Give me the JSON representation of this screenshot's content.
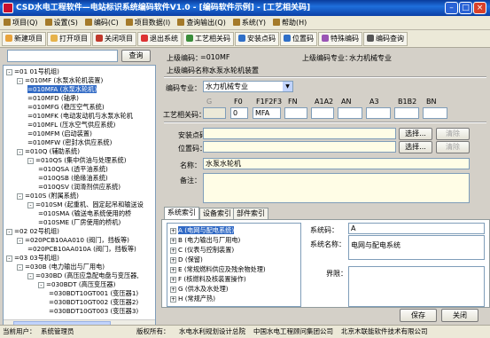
{
  "window": {
    "title": "CSD水电工程软件—电站标识系统编码软件V1.0 - [编码软件示例] - [工艺相关码]"
  },
  "menu": [
    {
      "label": "项目(Q)"
    },
    {
      "label": "设置(S)"
    },
    {
      "label": "编码(C)"
    },
    {
      "label": "项目数据(I)"
    },
    {
      "label": "查询输出(Q)"
    },
    {
      "label": "系统(Y)"
    },
    {
      "label": "帮助(H)"
    }
  ],
  "toolbar": [
    {
      "label": "新建项目",
      "icon": "new-project-icon",
      "color": "#e8a33c"
    },
    {
      "label": "打开项目",
      "icon": "open-project-icon",
      "color": "#e6b24a"
    },
    {
      "label": "关闭项目",
      "icon": "close-project-icon",
      "color": "#c0392b"
    },
    {
      "label": "退出系统",
      "icon": "exit-icon",
      "color": "#d33"
    },
    {
      "label": "工艺相关码",
      "icon": "process-code-icon",
      "color": "#3a8d3a"
    },
    {
      "label": "安装点码",
      "icon": "install-point-icon",
      "color": "#2f6fc7"
    },
    {
      "label": "位置码",
      "icon": "location-code-icon",
      "color": "#2f6fc7"
    },
    {
      "label": "特殊编码",
      "icon": "special-code-icon",
      "color": "#9a55b5"
    },
    {
      "label": "编码查询",
      "icon": "code-query-icon",
      "color": "#555"
    }
  ],
  "search": {
    "value": "",
    "button": "查询"
  },
  "tree": [
    {
      "label": "=01 01号机组)",
      "indent": 0,
      "exp": "-"
    },
    {
      "label": "=010MF (水泵水轮机装置)",
      "indent": 1,
      "exp": "-"
    },
    {
      "label": "=010MFA (水泵水轮机)",
      "indent": 2,
      "exp": "",
      "selected": true
    },
    {
      "label": "=010MFD (轴承)",
      "indent": 2,
      "exp": ""
    },
    {
      "label": "=010MFG (稳压空气系统)",
      "indent": 2,
      "exp": ""
    },
    {
      "label": "=010MFK (电动发动机与水泵水轮机",
      "indent": 2,
      "exp": ""
    },
    {
      "label": "=010MFL (压水空气供应系统)",
      "indent": 2,
      "exp": ""
    },
    {
      "label": "=010MFM (启动装置)",
      "indent": 2,
      "exp": ""
    },
    {
      "label": "=010MFW (密封水供应系统)",
      "indent": 2,
      "exp": ""
    },
    {
      "label": "=010Q (辅助系统)",
      "indent": 1,
      "exp": "-"
    },
    {
      "label": "=010QS (集中供油与处理系统)",
      "indent": 2,
      "exp": "-"
    },
    {
      "label": "=010QSA (透平油系统)",
      "indent": 3,
      "exp": ""
    },
    {
      "label": "=010QSB (绝缘油系统)",
      "indent": 3,
      "exp": ""
    },
    {
      "label": "=010QSV (润滑剂供应系统)",
      "indent": 3,
      "exp": ""
    },
    {
      "label": "=010S (附属系统)",
      "indent": 1,
      "exp": "-"
    },
    {
      "label": "=010SM (起重机、固定起吊和输送设",
      "indent": 2,
      "exp": "-"
    },
    {
      "label": "=010SMA (输送电系统使用的桥",
      "indent": 3,
      "exp": ""
    },
    {
      "label": "=010SME (厂房使用的桥机)",
      "indent": 3,
      "exp": ""
    },
    {
      "label": "=02 02号机组)",
      "indent": 0,
      "exp": "-"
    },
    {
      "label": "=020PCB10AA010 (阀门，挡板等)",
      "indent": 1,
      "exp": "-"
    },
    {
      "label": "=020PCB10AA010A (阀门，挡板等)",
      "indent": 2,
      "exp": ""
    },
    {
      "label": "=03 03号机组)",
      "indent": 0,
      "exp": "-"
    },
    {
      "label": "=030B (电力输出与厂用电)",
      "indent": 1,
      "exp": "-"
    },
    {
      "label": "=030BD (高压应急配电盘与变压器,",
      "indent": 2,
      "exp": "-"
    },
    {
      "label": "=030BDT (高压变压器)",
      "indent": 3,
      "exp": "-"
    },
    {
      "label": "=030BDT10GT001 (变压器1)",
      "indent": 4,
      "exp": ""
    },
    {
      "label": "=030BDT10GT002 (变压器2)",
      "indent": 4,
      "exp": ""
    },
    {
      "label": "=030BDT10GT003 (变压器3)",
      "indent": 4,
      "exp": ""
    }
  ],
  "detail": {
    "upper_code_label": "上级编码：",
    "upper_code": "=010MF",
    "upper_specialty_label": "上级编码专业：",
    "upper_specialty": "水力机械专业",
    "upper_name_label": "上级编码名称：",
    "upper_name": "水泵水轮机装置",
    "specialty_label": "编码专业：",
    "specialty": "水力机械专业",
    "process_label": "工艺相关码：",
    "code_headers": [
      "G",
      "F0",
      "F1F2F3",
      "FN",
      "A1A2",
      "AN",
      "A3",
      "B1B2",
      "BN"
    ],
    "code_values": [
      "",
      "0",
      "MFA",
      "",
      "",
      "",
      "",
      "",
      ""
    ],
    "install_label": "安装点码：",
    "install_value": "",
    "location_label": "位置码：",
    "location_value": "",
    "select_label": "选择...",
    "clear_label": "清除",
    "name_label": "名称：",
    "name_value": "水泵水轮机",
    "remark_label": "备注：",
    "remark_value": ""
  },
  "tabs": [
    {
      "label": "系统索引",
      "active": true
    },
    {
      "label": "设备索引"
    },
    {
      "label": "部件索引"
    }
  ],
  "system_tree": [
    {
      "label": "A (电网与配电系统)",
      "selected": true
    },
    {
      "label": "B (电力输出与厂用电)"
    },
    {
      "label": "C (仪表与控制装置)"
    },
    {
      "label": "D (保留)"
    },
    {
      "label": "E (常规燃料供应及残余物处理)"
    },
    {
      "label": "F (核燃料及核装置操作)"
    },
    {
      "label": "G (供水及水处理)"
    },
    {
      "label": "H (常规产热)"
    }
  ],
  "system_fields": {
    "code_label": "系统码：",
    "code_value": "A",
    "name_label": "系统名称：",
    "name_value": "电网与配电系统",
    "boundary_label": "界限："
  },
  "actions": {
    "save": "保存",
    "close": "关闭"
  },
  "status": {
    "user_label": "当前用户：",
    "user": "系统管理员",
    "copyright_label": "版权所有：",
    "org1": "水电水利规划设计总院",
    "org2": "中国水电工程顾问集团公司",
    "org3": "北京木联能软件技术有限公司"
  }
}
